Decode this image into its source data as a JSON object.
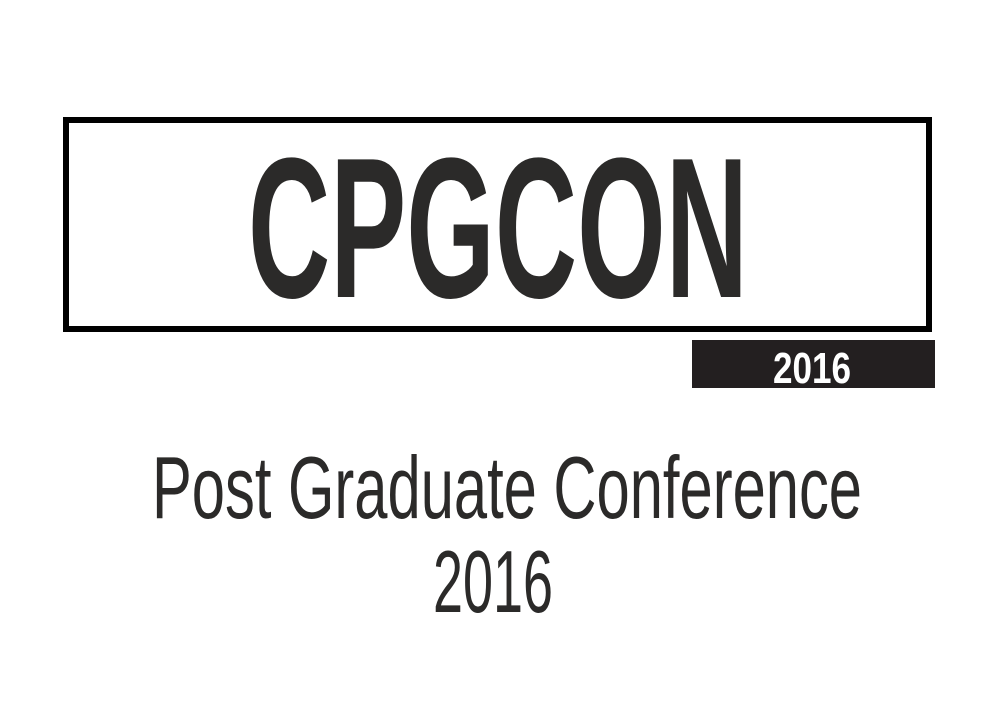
{
  "logo": {
    "title": "CPGCON",
    "badge_year": "2016"
  },
  "subtitle": {
    "line1": "Post Graduate Conference",
    "line2": "2016"
  },
  "colors": {
    "ink": "#2b2a29",
    "badge_bg": "#231f20",
    "frame": "#000000"
  }
}
